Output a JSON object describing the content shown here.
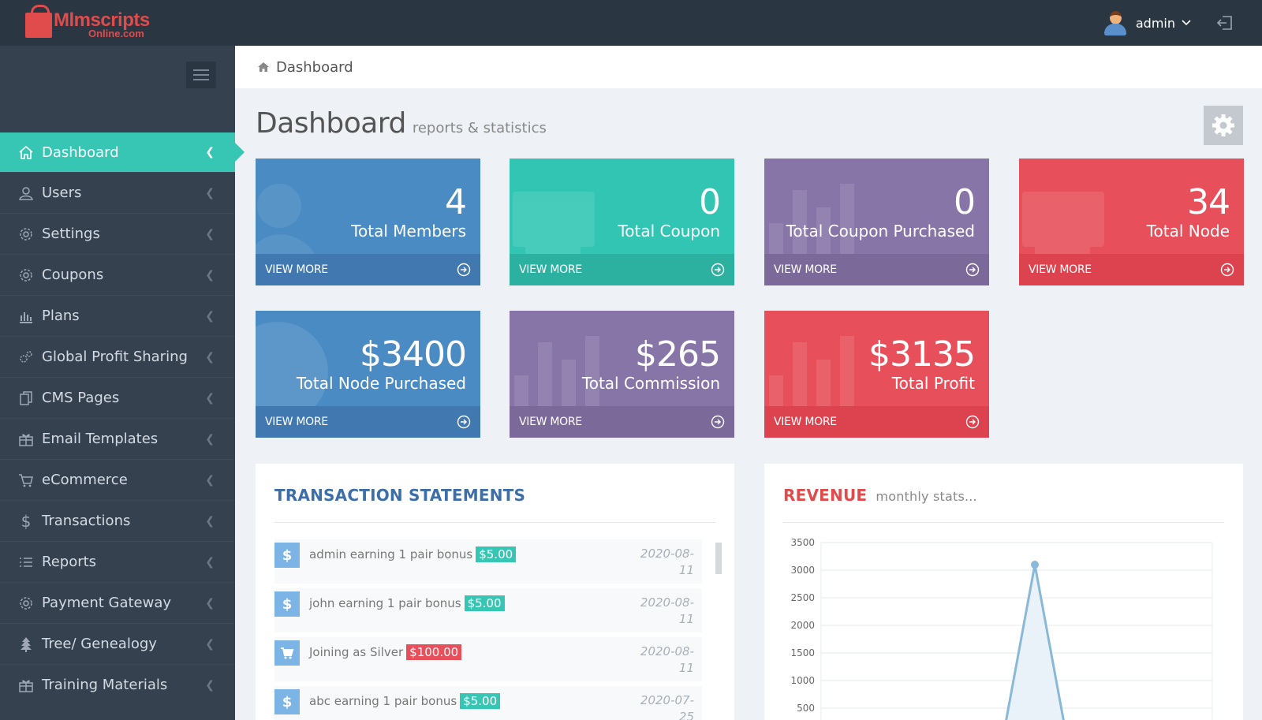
{
  "header": {
    "logo_main": "Mlmscripts",
    "logo_sub": "Online.com",
    "user_name": "admin"
  },
  "sidebar": {
    "items": [
      {
        "label": "Dashboard",
        "icon": "home-icon",
        "active": true
      },
      {
        "label": "Users",
        "icon": "user-icon"
      },
      {
        "label": "Settings",
        "icon": "settings-icon"
      },
      {
        "label": "Coupons",
        "icon": "settings-icon"
      },
      {
        "label": "Plans",
        "icon": "bar-chart-icon"
      },
      {
        "label": "Global Profit Sharing",
        "icon": "cogs-icon"
      },
      {
        "label": "CMS Pages",
        "icon": "copy-icon"
      },
      {
        "label": "Email Templates",
        "icon": "gift-icon"
      },
      {
        "label": "eCommerce",
        "icon": "cart-icon"
      },
      {
        "label": "Transactions",
        "icon": "dollar-icon"
      },
      {
        "label": "Reports",
        "icon": "list-icon"
      },
      {
        "label": "Payment Gateway",
        "icon": "settings-icon"
      },
      {
        "label": "Tree/ Genealogy",
        "icon": "tree-icon"
      },
      {
        "label": "Training Materials",
        "icon": "gift-icon"
      }
    ]
  },
  "breadcrumb": {
    "label": "Dashboard"
  },
  "page": {
    "title": "Dashboard",
    "subtitle": "reports & statistics"
  },
  "tiles": [
    {
      "value": "4",
      "label": "Total Members",
      "more": "VIEW MORE",
      "color": "#4b8bc3"
    },
    {
      "value": "0",
      "label": "Total Coupon",
      "more": "VIEW MORE",
      "color": "#32c5b3"
    },
    {
      "value": "0",
      "label": "Total Coupon Purchased",
      "more": "VIEW MORE",
      "color": "#8775a7"
    },
    {
      "value": "34",
      "label": "Total Node",
      "more": "VIEW MORE",
      "color": "#e7505a"
    },
    {
      "value": "$3400",
      "label": "Total Node Purchased",
      "more": "VIEW MORE",
      "color": "#4b8bc3"
    },
    {
      "value": "$265",
      "label": "Total Commission",
      "more": "VIEW MORE",
      "color": "#8775a7"
    },
    {
      "value": "$3135",
      "label": "Total Profit",
      "more": "VIEW MORE",
      "color": "#e7505a"
    }
  ],
  "transactions": {
    "title": "TRANSACTION STATEMENTS",
    "rows": [
      {
        "icon": "dollar-icon",
        "text": "admin earning 1 pair bonus",
        "amount": "$5.00",
        "amount_color": "#36c6b3",
        "date_a": "2020-08-",
        "date_b": "11"
      },
      {
        "icon": "dollar-icon",
        "text": "john earning 1 pair bonus",
        "amount": "$5.00",
        "amount_color": "#36c6b3",
        "date_a": "2020-08-",
        "date_b": "11"
      },
      {
        "icon": "cart-icon",
        "text": "Joining as Silver",
        "amount": "$100.00",
        "amount_color": "#e7505a",
        "date_a": "2020-08-",
        "date_b": "11"
      },
      {
        "icon": "dollar-icon",
        "text": "abc earning 1 pair bonus",
        "amount": "$5.00",
        "amount_color": "#36c6b3",
        "date_a": "2020-07-",
        "date_b": "25"
      }
    ]
  },
  "revenue": {
    "title": "REVENUE",
    "subtitle": "monthly stats..."
  },
  "chart_data": {
    "type": "area",
    "yticks": [
      500,
      1000,
      1500,
      2000,
      2500,
      3000,
      3500
    ],
    "ylim": [
      0,
      3500
    ],
    "series": [
      {
        "values": [
          0,
          3100,
          0
        ]
      }
    ],
    "color": "#89b9d8",
    "grid": true
  }
}
